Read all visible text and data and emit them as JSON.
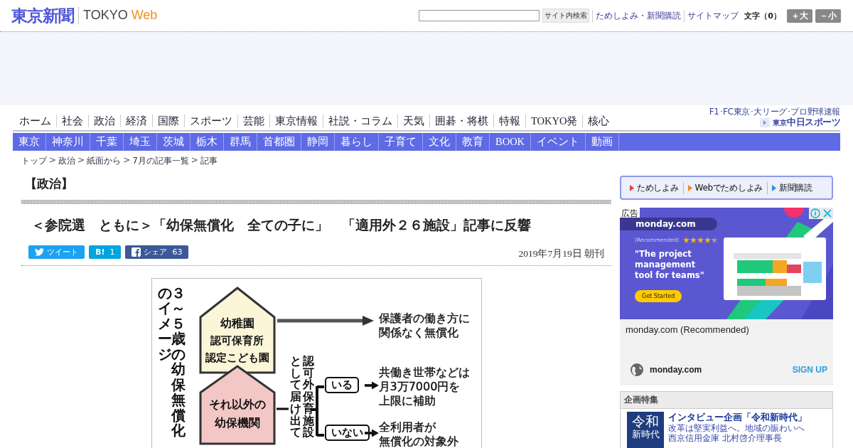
{
  "logo": {
    "name": "東京新聞",
    "sub": "TOKYO",
    "web": "Web"
  },
  "header": {
    "search_button": "サイト内検索",
    "links": [
      "ためしよみ・新聞購読",
      "サイトマップ"
    ],
    "font_size_label": "文字（0）",
    "font_buttons": [
      "＋大",
      "－小"
    ]
  },
  "nav_main": [
    "ホーム",
    "社会",
    "政治",
    "経済",
    "国際",
    "スポーツ",
    "芸能",
    "東京情報",
    "社説・コラム",
    "天気",
    "囲碁・将棋",
    "特報",
    "TOKYO発",
    "核心"
  ],
  "sports_link": {
    "tagline": "F1･FC東京･大リーグ･プロ野球速報",
    "logo_small": "東京",
    "logo": "中日スポーツ"
  },
  "nav_regional": [
    "東京",
    "神奈川",
    "千葉",
    "埼玉",
    "茨城",
    "栃木",
    "群馬",
    "首都圏",
    "静岡",
    "暮らし",
    "子育て",
    "文化",
    "教育",
    "BOOK",
    "イベント",
    "動画"
  ],
  "breadcrumb": {
    "separator": ">",
    "items": [
      "トップ",
      "政治",
      "紙面から",
      "7月の記事一覧",
      "記事"
    ]
  },
  "article": {
    "category": "【政治】",
    "title": "＜参院選　ともに＞「幼保無償化　全ての子に」　「適用外２６施設」記事に反響",
    "share": [
      {
        "kind": "twitter",
        "label": "ツイート"
      },
      {
        "kind": "hatena",
        "label": "B!",
        "count": "1"
      },
      {
        "kind": "facebook",
        "label": "シェア",
        "count": "63"
      }
    ],
    "date": "2019年7月19日 朝刊",
    "figure": {
      "title_lines": [
        "のイメージ",
        "３～５歳の幼保無償化"
      ],
      "top_box": {
        "lines": [
          "幼稚園",
          "認可保育所",
          "認定こども園"
        ],
        "result": [
          "保護者の働き方に",
          "関係なく無償化"
        ]
      },
      "bottom_box": {
        "lines": [
          "それ以外の",
          "幼保機関"
        ]
      },
      "condition_lines": [
        "として届け出て",
        "認可外保育施設"
      ],
      "branches": [
        {
          "label": "いる",
          "result": [
            "共働き世帯などは",
            "月3万7000円を",
            "上限に補助"
          ]
        },
        {
          "label": "いない",
          "result": [
            "全利用者が",
            "無償化の対象外"
          ]
        }
      ]
    }
  },
  "sidebar": {
    "trial_links": [
      {
        "label": "ためしよみ",
        "color": "#e8412c"
      },
      {
        "label": "Webでためしよみ",
        "color": "#f08a1c"
      },
      {
        "label": "新聞購読",
        "color": "#2f8be0"
      }
    ],
    "ad": {
      "badge": "広告",
      "brand": "monday.com",
      "rating_label": "(Recommended)",
      "stars": 4.5,
      "headline": "\"The project management tool for teams\"",
      "cta": "Get Started",
      "title": "monday.com (Recommended)",
      "domain": "monday.com",
      "action": "SIGN UP"
    },
    "feature": {
      "heading": "企画特集",
      "thumb_lines": [
        "令和",
        "新時代"
      ],
      "title": "インタビュー企画「令和新時代」",
      "text": [
        "改革は堅実利益へ。地域の賑わいへ",
        "西京信用金庫 北村啓介理事長"
      ]
    }
  }
}
